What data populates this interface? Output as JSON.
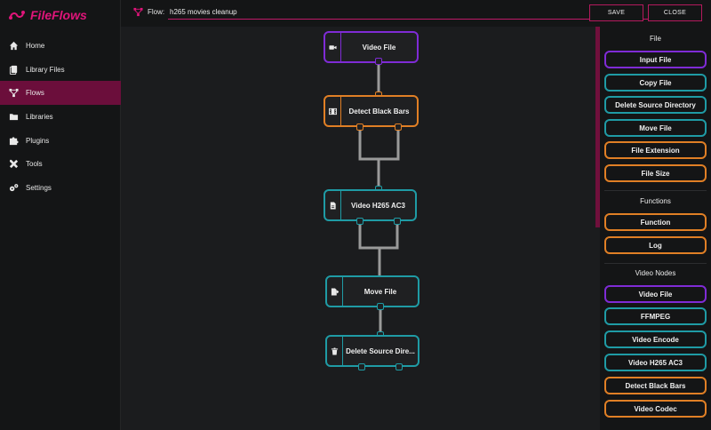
{
  "app": {
    "name": "FileFlows",
    "accent": "#e0157a"
  },
  "sidebar": {
    "items": [
      {
        "label": "Home",
        "icon": "home-icon"
      },
      {
        "label": "Library Files",
        "icon": "files-icon"
      },
      {
        "label": "Flows",
        "icon": "flow-icon",
        "active": true
      },
      {
        "label": "Libraries",
        "icon": "folder-icon"
      },
      {
        "label": "Plugins",
        "icon": "puzzle-icon"
      },
      {
        "label": "Tools",
        "icon": "tools-icon"
      },
      {
        "label": "Settings",
        "icon": "gears-icon"
      }
    ]
  },
  "topbar": {
    "flow_label": "Flow:",
    "flow_name": "h265 movies cleanup",
    "save_label": "SAVE",
    "close_label": "CLOSE"
  },
  "flow": {
    "nodes": [
      {
        "label": "Video File",
        "color": "purple",
        "icon": "video-camera-icon"
      },
      {
        "label": "Detect Black Bars",
        "color": "orange",
        "icon": "film-icon"
      },
      {
        "label": "Video H265 AC3",
        "color": "teal",
        "icon": "file-icon"
      },
      {
        "label": "Move File",
        "color": "teal",
        "icon": "file-move-icon"
      },
      {
        "label": "Delete Source Dire...",
        "color": "teal",
        "icon": "trash-icon"
      }
    ]
  },
  "panel": {
    "sections": [
      {
        "title": "File",
        "items": [
          {
            "label": "Input File",
            "color": "purple"
          },
          {
            "label": "Copy File",
            "color": "teal"
          },
          {
            "label": "Delete Source Directory",
            "color": "teal"
          },
          {
            "label": "Move File",
            "color": "teal"
          },
          {
            "label": "File Extension",
            "color": "orange"
          },
          {
            "label": "File Size",
            "color": "orange"
          }
        ]
      },
      {
        "title": "Functions",
        "items": [
          {
            "label": "Function",
            "color": "orange"
          },
          {
            "label": "Log",
            "color": "orange"
          }
        ]
      },
      {
        "title": "Video Nodes",
        "items": [
          {
            "label": "Video File",
            "color": "purple"
          },
          {
            "label": "FFMPEG",
            "color": "teal"
          },
          {
            "label": "Video Encode",
            "color": "teal"
          },
          {
            "label": "Video H265 AC3",
            "color": "teal"
          },
          {
            "label": "Detect Black Bars",
            "color": "orange"
          },
          {
            "label": "Video Codec",
            "color": "orange"
          }
        ]
      }
    ]
  },
  "colors": {
    "purple": "#7f2bd6",
    "orange": "#e07f25",
    "teal": "#1f9ba5",
    "wire": "#9a9a9a"
  }
}
